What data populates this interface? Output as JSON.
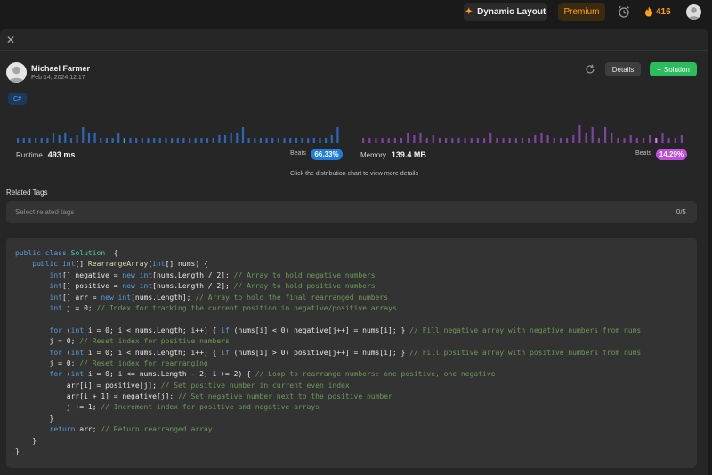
{
  "topbar": {
    "layout_label": "Dynamic Layout",
    "premium_label": "Premium",
    "streak_count": "416",
    "icons": {
      "layout": "sparkle-icon",
      "alarm": "alarm-clock-icon",
      "streak": "flame-icon",
      "avatar": "user-avatar"
    }
  },
  "post": {
    "author": "Michael Farmer",
    "date": "Feb 14, 2024 12:17",
    "details_label": "Details",
    "solution_label": "Solution",
    "language_tag": "C#"
  },
  "stats": {
    "runtime_label": "Runtime",
    "runtime_value": "493 ms",
    "runtime_beats_label": "Beats",
    "runtime_beats": "66.33%",
    "memory_label": "Memory",
    "memory_value": "139.4 MB",
    "memory_beats_label": "Beats",
    "memory_beats": "14.29%",
    "hint": "Click the distribution chart to view more details",
    "colors": {
      "runtime": "#2e7de9",
      "runtime_highlight": "#4ba3ff",
      "memory": "#9b4dca",
      "memory_highlight": "#d77bff",
      "runtime_badge": "#1f7de0",
      "memory_badge": "#c04de0"
    }
  },
  "tags": {
    "title": "Related Tags",
    "placeholder": "Select related tags",
    "count": "0/5"
  },
  "code": {
    "language": "csharp",
    "lines": [
      [
        [
          "kw",
          "public class "
        ],
        [
          "ty",
          "Solution"
        ],
        [
          "",
          "  {"
        ]
      ],
      [
        [
          "",
          "    "
        ],
        [
          "kw",
          "public "
        ],
        [
          "kw",
          "int"
        ],
        [
          "",
          "[] "
        ],
        [
          "fn",
          "RearrangeArray"
        ],
        [
          "",
          "("
        ],
        [
          "kw",
          "int"
        ],
        [
          "",
          "[] nums) {"
        ]
      ],
      [
        [
          "",
          "        "
        ],
        [
          "kw",
          "int"
        ],
        [
          "",
          "[] negative = "
        ],
        [
          "kw",
          "new "
        ],
        [
          "kw",
          "int"
        ],
        [
          "",
          "[nums.Length / 2]; "
        ],
        [
          "cm",
          "// Array to hold negative numbers"
        ]
      ],
      [
        [
          "",
          "        "
        ],
        [
          "kw",
          "int"
        ],
        [
          "",
          "[] positive = "
        ],
        [
          "kw",
          "new "
        ],
        [
          "kw",
          "int"
        ],
        [
          "",
          "[nums.Length / 2]; "
        ],
        [
          "cm",
          "// Array to hold positive numbers"
        ]
      ],
      [
        [
          "",
          "        "
        ],
        [
          "kw",
          "int"
        ],
        [
          "",
          "[] arr = "
        ],
        [
          "kw",
          "new "
        ],
        [
          "kw",
          "int"
        ],
        [
          "",
          "[nums.Length]; "
        ],
        [
          "cm",
          "// Array to hold the final rearranged numbers"
        ]
      ],
      [
        [
          "",
          "        "
        ],
        [
          "kw",
          "int"
        ],
        [
          "",
          " j = 0; "
        ],
        [
          "cm",
          "// Index for tracking the current position in negative/positive arrays"
        ]
      ],
      [
        [
          "",
          ""
        ]
      ],
      [
        [
          "",
          "        "
        ],
        [
          "kw",
          "for"
        ],
        [
          "",
          " ("
        ],
        [
          "kw",
          "int"
        ],
        [
          "",
          " i = 0; i < nums.Length; i++) { "
        ],
        [
          "kw",
          "if"
        ],
        [
          "",
          " (nums[i] < 0) negative[j++] = nums[i]; } "
        ],
        [
          "cm",
          "// Fill negative array with negative numbers from nums"
        ]
      ],
      [
        [
          "",
          "        j = 0; "
        ],
        [
          "cm",
          "// Reset index for positive numbers"
        ]
      ],
      [
        [
          "",
          "        "
        ],
        [
          "kw",
          "for"
        ],
        [
          "",
          " ("
        ],
        [
          "kw",
          "int"
        ],
        [
          "",
          " i = 0; i < nums.Length; i++) { "
        ],
        [
          "kw",
          "if"
        ],
        [
          "",
          " (nums[i] > 0) positive[j++] = nums[i]; } "
        ],
        [
          "cm",
          "// Fill positive array with positive numbers from nums"
        ]
      ],
      [
        [
          "",
          "        j = 0; "
        ],
        [
          "cm",
          "// Reset index for rearranging"
        ]
      ],
      [
        [
          "",
          "        "
        ],
        [
          "kw",
          "for"
        ],
        [
          "",
          " ("
        ],
        [
          "kw",
          "int"
        ],
        [
          "",
          " i = 0; i <= nums.Length - 2; i += 2) { "
        ],
        [
          "cm",
          "// Loop to rearrange numbers: one positive, one negative"
        ]
      ],
      [
        [
          "",
          "            arr[i] = positive[j]; "
        ],
        [
          "cm",
          "// Set positive number in current even index"
        ]
      ],
      [
        [
          "",
          "            arr[i + 1] = negative[j]; "
        ],
        [
          "cm",
          "// Set negative number next to the positive number"
        ]
      ],
      [
        [
          "",
          "            j += 1; "
        ],
        [
          "cm",
          "// Increment index for positive and negative arrays"
        ]
      ],
      [
        [
          "",
          "        }"
        ]
      ],
      [
        [
          "",
          "        "
        ],
        [
          "kw",
          "return"
        ],
        [
          "",
          " arr; "
        ],
        [
          "cm",
          "// Return rearranged array"
        ]
      ],
      [
        [
          "",
          "    }"
        ]
      ],
      [
        [
          "",
          "}"
        ]
      ]
    ]
  }
}
